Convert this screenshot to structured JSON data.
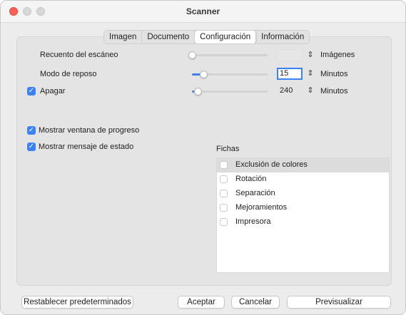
{
  "window": {
    "title": "Scanner"
  },
  "tabs": [
    {
      "label": "Imagen",
      "active": false
    },
    {
      "label": "Documento",
      "active": false
    },
    {
      "label": "Configuración",
      "active": true
    },
    {
      "label": "Información",
      "active": false
    }
  ],
  "settings": {
    "scan_count": {
      "label": "Recuento del escáneo",
      "value": "",
      "unit": "Imágenes",
      "slider_fraction": 0.0,
      "enabled": false
    },
    "sleep_mode": {
      "label": "Modo de reposo",
      "value": "15",
      "unit": "Minutos",
      "slider_fraction": 0.15,
      "focused": true
    },
    "power_off": {
      "label": "Apagar",
      "checked": true,
      "value": "240",
      "unit": "Minutos",
      "slider_fraction": 0.08
    }
  },
  "options": {
    "show_progress": {
      "label": "Mostrar ventana de progreso",
      "checked": true
    },
    "show_status": {
      "label": "Mostrar mensaje de estado",
      "checked": true
    }
  },
  "fichas": {
    "heading": "Fichas",
    "items": [
      {
        "label": "Exclusión de colores",
        "checked": false,
        "selected": true
      },
      {
        "label": "Rotación",
        "checked": false,
        "selected": false
      },
      {
        "label": "Separación",
        "checked": false,
        "selected": false
      },
      {
        "label": "Mejoramientos",
        "checked": false,
        "selected": false
      },
      {
        "label": "Impresora",
        "checked": false,
        "selected": false
      }
    ]
  },
  "buttons": {
    "reset": "Restablecer predeterminados",
    "accept": "Aceptar",
    "cancel": "Cancelar",
    "preview": "Previsualizar"
  },
  "colors": {
    "accent": "#3c82f6",
    "close": "#ff5f57"
  }
}
